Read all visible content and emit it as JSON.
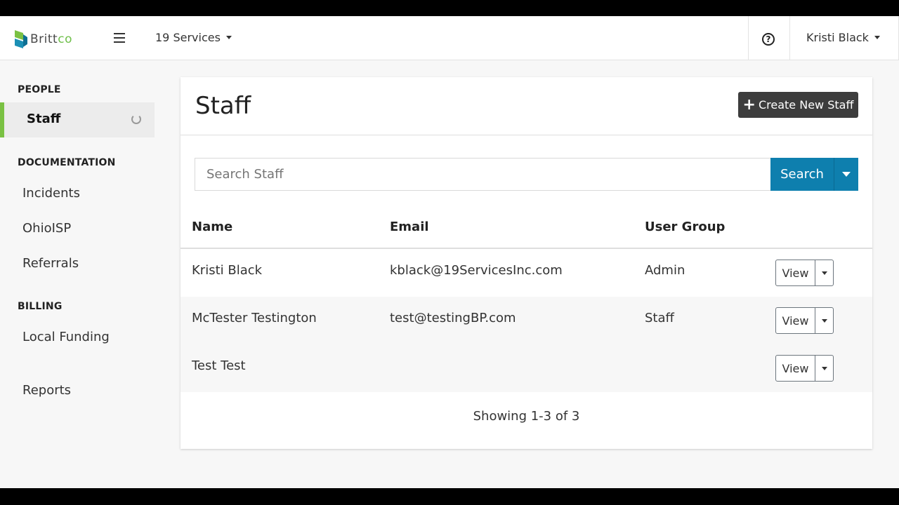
{
  "navbar": {
    "brand_main": "Britt",
    "brand_accent": "co",
    "org_label": "19 Services",
    "help_glyph": "?",
    "user_label": "Kristi Black"
  },
  "sidebar": {
    "people_title": "PEOPLE",
    "staff_label": "Staff",
    "documentation_title": "DOCUMENTATION",
    "incidents_label": "Incidents",
    "ohioisp_label": "OhioISP",
    "referrals_label": "Referrals",
    "billing_title": "BILLING",
    "local_funding_label": "Local Funding",
    "reports_label": "Reports"
  },
  "page": {
    "title": "Staff",
    "create_button": "Create New Staff"
  },
  "search": {
    "placeholder": "Search Staff",
    "button": "Search"
  },
  "table": {
    "headers": {
      "name": "Name",
      "email": "Email",
      "group": "User Group"
    },
    "rows": [
      {
        "name": "Kristi Black",
        "email": "kblack@19ServicesInc.com",
        "group": "Admin",
        "action": "View"
      },
      {
        "name": "McTester Testington",
        "email": "test@testingBP.com",
        "group": "Staff",
        "action": "View"
      },
      {
        "name": "Test Test",
        "email": "",
        "group": "",
        "action": "View"
      }
    ]
  },
  "pagination": {
    "summary": "Showing 1-3 of 3"
  },
  "colors": {
    "accent_green": "#7ac143",
    "primary_blue": "#0e7fae",
    "dark_button": "#3d3d3d"
  }
}
